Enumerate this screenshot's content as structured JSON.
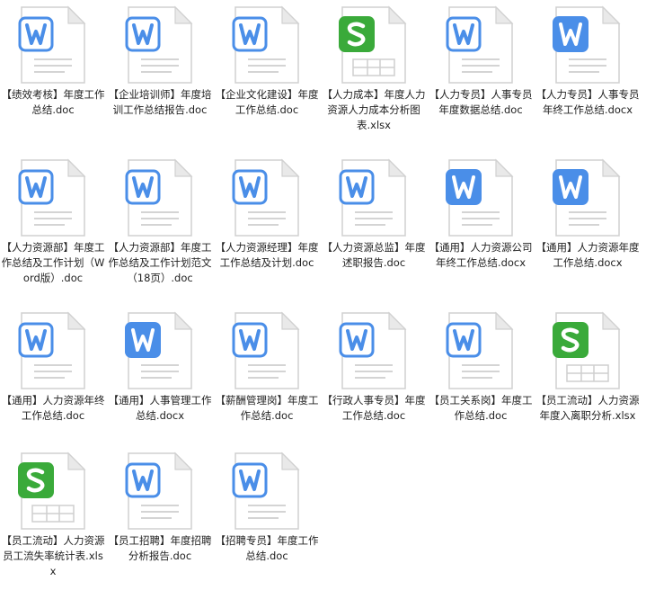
{
  "colors": {
    "doc_badge": "#4a8ee8",
    "doc_badge_light": "#ffffff",
    "doc_stroke": "#4a8ee8",
    "docx_badge": "#4a8ee8",
    "xlsx_badge": "#3aaa3a",
    "page": "#ffffff",
    "page_stroke": "#d0d0d0",
    "fold": "#e9e9e9",
    "text": "#222222"
  },
  "files": [
    {
      "name": "【绩效考核】年度工作总结.doc",
      "type": "doc"
    },
    {
      "name": "【企业培训师】年度培训工作总结报告.doc",
      "type": "doc"
    },
    {
      "name": "【企业文化建设】年度工作总结.doc",
      "type": "doc"
    },
    {
      "name": "【人力成本】年度人力资源人力成本分析图表.xlsx",
      "type": "xlsx"
    },
    {
      "name": "【人力专员】人事专员年度数据总结.doc",
      "type": "doc"
    },
    {
      "name": "【人力专员】人事专员年终工作总结.docx",
      "type": "docx"
    },
    {
      "name": "【人力资源部】年度工作总结及工作计划（Word版）.doc",
      "type": "doc"
    },
    {
      "name": "【人力资源部】年度工作总结及工作计划范文（18页）.doc",
      "type": "doc"
    },
    {
      "name": "【人力资源经理】年度工作总结及计划.doc",
      "type": "doc"
    },
    {
      "name": "【人力资源总监】年度述职报告.doc",
      "type": "doc"
    },
    {
      "name": "【通用】人力资源公司年终工作总结.docx",
      "type": "docx"
    },
    {
      "name": "【通用】人力资源年度工作总结.docx",
      "type": "docx"
    },
    {
      "name": "【通用】人力资源年终工作总结.doc",
      "type": "doc"
    },
    {
      "name": "【通用】人事管理工作总结.docx",
      "type": "docx"
    },
    {
      "name": "【薪酬管理岗】年度工作总结.doc",
      "type": "doc"
    },
    {
      "name": "【行政人事专员】年度工作总结.doc",
      "type": "doc"
    },
    {
      "name": "【员工关系岗】年度工作总结.doc",
      "type": "doc"
    },
    {
      "name": "【员工流动】人力资源年度入离职分析.xlsx",
      "type": "xlsx"
    },
    {
      "name": "【员工流动】人力资源员工流失率统计表.xlsx",
      "type": "xlsx"
    },
    {
      "name": "【员工招聘】年度招聘分析报告.doc",
      "type": "doc"
    },
    {
      "name": "【招聘专员】年度工作总结.doc",
      "type": "doc"
    }
  ]
}
